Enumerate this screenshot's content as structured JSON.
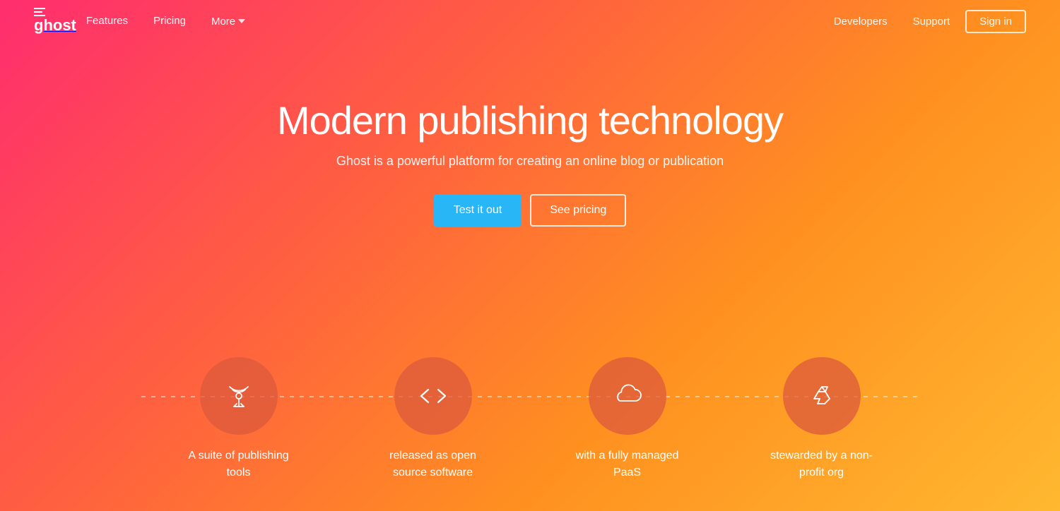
{
  "nav": {
    "logo_text": "ghost",
    "links": [
      {
        "label": "Features",
        "id": "features"
      },
      {
        "label": "Pricing",
        "id": "pricing"
      },
      {
        "label": "More",
        "id": "more",
        "has_dropdown": true
      }
    ],
    "right_links": [
      {
        "label": "Developers",
        "id": "developers"
      },
      {
        "label": "Support",
        "id": "support"
      }
    ],
    "signin_label": "Sign in"
  },
  "hero": {
    "title": "Modern publishing technology",
    "subtitle": "Ghost is a powerful platform for creating an online blog or publication",
    "btn_primary": "Test it out",
    "btn_secondary": "See pricing"
  },
  "features": [
    {
      "id": "publishing-tools",
      "icon": "antenna",
      "label": "A suite of publishing tools"
    },
    {
      "id": "open-source",
      "icon": "code",
      "label": "released as open source software"
    },
    {
      "id": "paas",
      "icon": "cloud",
      "label": "with a fully managed PaaS"
    },
    {
      "id": "nonprofit",
      "icon": "recycle",
      "label": "stewarded by a non-profit org"
    }
  ]
}
